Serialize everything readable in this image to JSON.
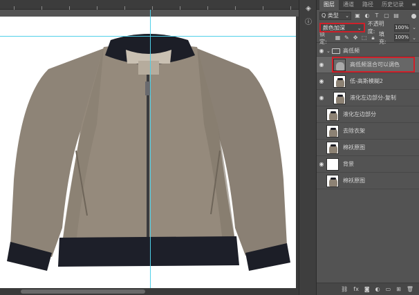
{
  "panel": {
    "tabs": [
      "图层",
      "通道",
      "路径",
      "历史记录"
    ],
    "kind_select": "Q 类型",
    "blend_mode": "颜色加深",
    "opacity_label": "不透明度:",
    "opacity_value": "100%",
    "lock_label": "锁定:",
    "fill_label": "填充:",
    "fill_value": "100%"
  },
  "layers": {
    "group_name": "高低频",
    "items": [
      {
        "name": "高低频混合可以调色",
        "selected": true
      },
      {
        "name": "低-高斯模糊2",
        "selected": false
      },
      {
        "name": "液化左边部分-复制",
        "selected": false
      },
      {
        "name": "液化左边部分",
        "selected": false
      },
      {
        "name": "去除衣架",
        "selected": false
      },
      {
        "name": "棉袄原图",
        "selected": false
      },
      {
        "name": "背景",
        "selected": false
      },
      {
        "name": "棉袄原图",
        "selected": false
      }
    ]
  },
  "icons": {
    "eye": "eye-icon",
    "folder": "folder-icon",
    "link": "link-icon",
    "fx": "fx-icon",
    "mask": "mask-icon",
    "adjust": "adjustment-icon",
    "new_group": "new-group-icon",
    "new_layer": "new-layer-icon",
    "trash": "trash-icon"
  }
}
